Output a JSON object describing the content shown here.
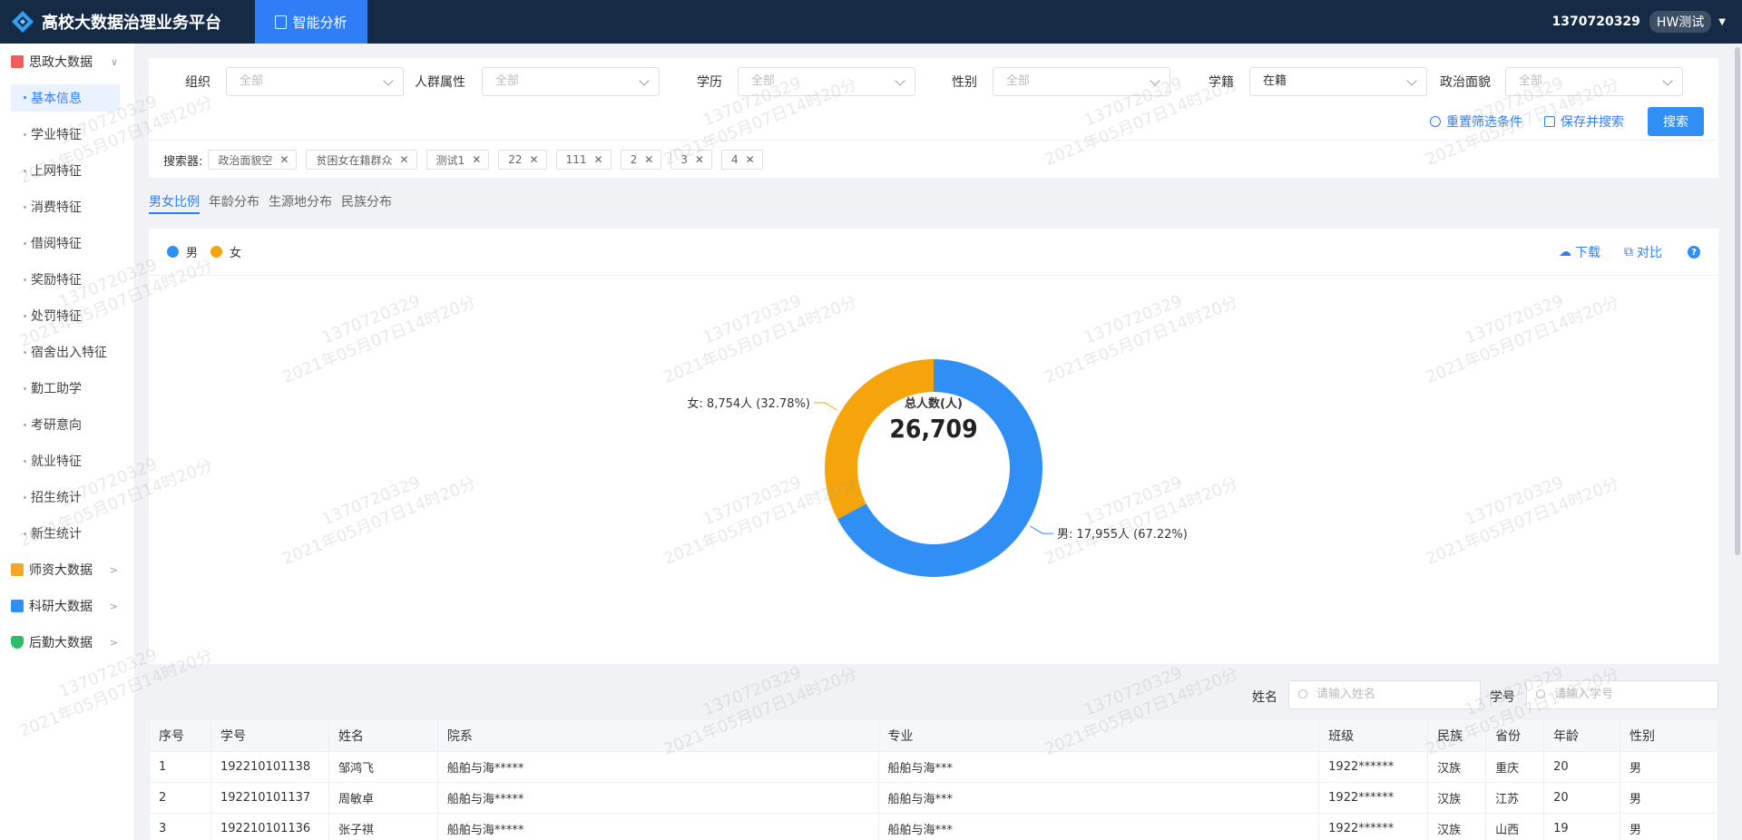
{
  "header": {
    "app_title": "高校大数据治理业务平台",
    "nav_tab": "智能分析",
    "user_id": "1370720329",
    "user_badge": "HW测试"
  },
  "sidebar": {
    "sections": [
      {
        "label": "思政大数据",
        "color": "#f25c5c",
        "icon": "book-icon"
      },
      {
        "label": "师资大数据",
        "color": "#f5a623",
        "icon": "teacher-icon"
      },
      {
        "label": "科研大数据",
        "color": "#2f8ff5",
        "icon": "research-icon"
      },
      {
        "label": "后勤大数据",
        "color": "#2cbd6a",
        "icon": "shield-icon"
      }
    ],
    "items": [
      "基本信息",
      "学业特征",
      "上网特征",
      "消费特征",
      "借阅特征",
      "奖励特征",
      "处罚特征",
      "宿舍出入特征",
      "勤工助学",
      "考研意向",
      "就业特征",
      "招生统计",
      "新生统计"
    ]
  },
  "filters": {
    "org_label": "组织",
    "org_value": "全部",
    "group_label": "人群属性",
    "group_value": "全部",
    "edu_label": "学历",
    "edu_value": "全部",
    "gender_label": "性别",
    "gender_value": "全部",
    "status_label": "学籍",
    "status_value": "在籍",
    "politics_label": "政治面貌",
    "politics_value": "全部",
    "reset_label": "重置筛选条件",
    "save_label": "保存并搜索",
    "search_label": "搜索",
    "searchers_label": "搜索器:",
    "chips": [
      "政治面貌空",
      "贫困女在籍群众",
      "测试1",
      "22",
      "111",
      "2",
      "3",
      "4"
    ]
  },
  "tabs": [
    "男女比例",
    "年龄分布",
    "生源地分布",
    "民族分布"
  ],
  "chart_panel": {
    "download_label": "下载",
    "compare_label": "对比",
    "help_label": "?"
  },
  "chart_data": {
    "type": "pie",
    "variant": "donut",
    "series": [
      {
        "name": "男",
        "value": 17955,
        "percent": 67.22,
        "color": "#2f8ff5",
        "label": "男: 17,955人 (67.22%)"
      },
      {
        "name": "女",
        "value": 8754,
        "percent": 32.78,
        "color": "#f5a40c",
        "label": "女: 8,754人 (32.78%)"
      }
    ],
    "center_title": "总人数(人)",
    "center_value": "26,709",
    "legend_position": "top-left"
  },
  "table_search": {
    "name_label": "姓名",
    "name_placeholder": "请输入姓名",
    "id_label": "学号",
    "id_placeholder": "请输入学号"
  },
  "table": {
    "headers": [
      "序号",
      "学号",
      "姓名",
      "院系",
      "专业",
      "班级",
      "民族",
      "省份",
      "年龄",
      "性别"
    ],
    "rows": [
      [
        "1",
        "192210101138",
        "邹鸿飞",
        "船舶与海*****",
        "船舶与海***",
        "1922******",
        "汉族",
        "重庆",
        "20",
        "男"
      ],
      [
        "2",
        "192210101137",
        "周敏卓",
        "船舶与海*****",
        "船舶与海***",
        "1922******",
        "汉族",
        "江苏",
        "20",
        "男"
      ],
      [
        "3",
        "192210101136",
        "张子祺",
        "船舶与海*****",
        "船舶与海***",
        "1922******",
        "汉族",
        "山西",
        "19",
        "男"
      ]
    ]
  },
  "watermark": {
    "line1": "1370720329",
    "line2": "2021年05月07日14时20分"
  }
}
